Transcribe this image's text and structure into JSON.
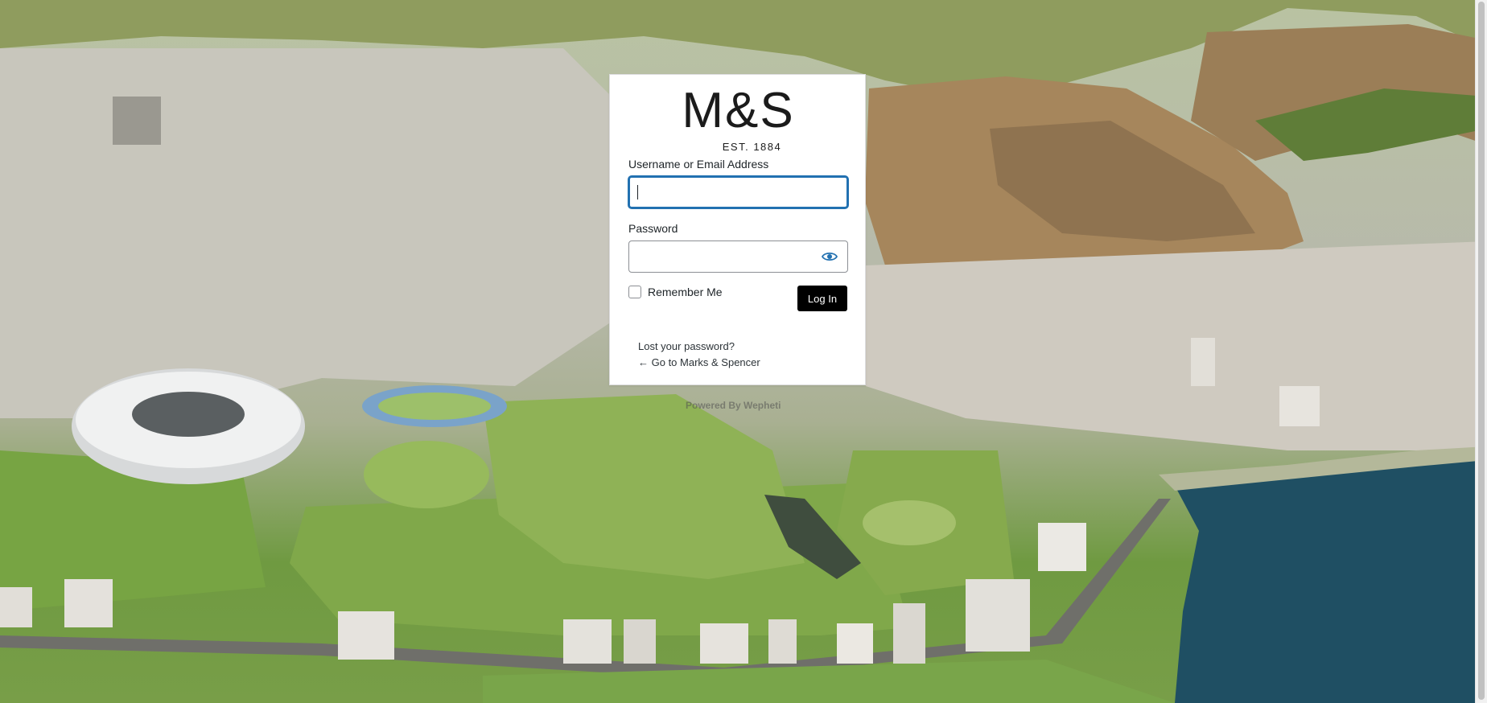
{
  "brand": {
    "logo_mark": "M&S",
    "logo_tagline": "EST. 1884"
  },
  "login_form": {
    "username_label": "Username or Email Address",
    "username_value": "",
    "password_label": "Password",
    "password_value": "",
    "show_password_icon": "eye-icon",
    "remember_me_label": "Remember Me",
    "remember_me_checked": false,
    "submit_label": "Log In"
  },
  "links": {
    "lost_password": "Lost your password?",
    "back_to_site": "← Go to Marks & Spencer"
  },
  "footer": {
    "powered_by": "Powered By Wepheti"
  },
  "colors": {
    "accent_focus": "#2271b1",
    "button_bg": "#000000",
    "button_text": "#ffffff",
    "ocean": "#1f4f63"
  }
}
